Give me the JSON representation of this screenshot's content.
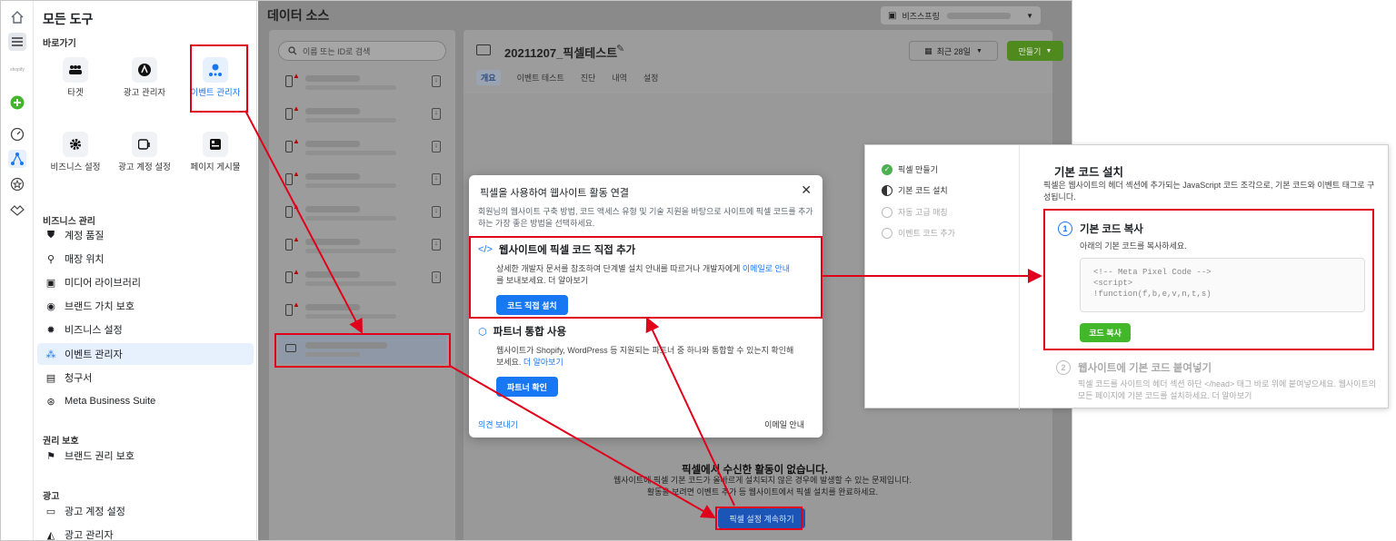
{
  "left_rail": {
    "icons": [
      "home-icon",
      "menu-icon",
      "shopify-logo",
      "add-icon",
      "dashboard-icon",
      "network-icon",
      "star-icon",
      "handshake-icon"
    ],
    "shopify_text": "shopify"
  },
  "tools": {
    "title": "모든 도구",
    "shortcuts_header": "바로가기",
    "shortcuts": [
      {
        "label": "타겟",
        "icon": "audience-icon"
      },
      {
        "label": "광고 관리자",
        "icon": "ads-manager-icon"
      },
      {
        "label": "이벤트 관리자",
        "icon": "events-manager-icon"
      },
      {
        "label": "비즈니스 설정",
        "icon": "gear-icon"
      },
      {
        "label": "광고 계정 설정",
        "icon": "ad-account-icon"
      },
      {
        "label": "페이지 게시물",
        "icon": "page-posts-icon"
      }
    ],
    "biz_header": "비즈니스 관리",
    "biz_items": [
      {
        "label": "계정 품질",
        "icon": "shield-icon"
      },
      {
        "label": "매장 위치",
        "icon": "location-icon"
      },
      {
        "label": "미디어 라이브러리",
        "icon": "media-icon"
      },
      {
        "label": "브랜드 가치 보호",
        "icon": "brand-icon"
      },
      {
        "label": "비즈니스 설정",
        "icon": "gear-icon"
      },
      {
        "label": "이벤트 관리자",
        "icon": "events-manager-icon"
      },
      {
        "label": "청구서",
        "icon": "invoice-icon"
      },
      {
        "label": "Meta Business Suite",
        "icon": "meta-icon"
      }
    ],
    "rights_header": "권리 보호",
    "rights_items": [
      {
        "label": "브랜드 권리 보호",
        "icon": "flag-icon"
      }
    ],
    "ads_header": "광고",
    "ads_items": [
      {
        "label": "광고 계정 설정",
        "icon": "ad-account-icon"
      },
      {
        "label": "광고 관리자",
        "icon": "ads-manager-icon"
      }
    ]
  },
  "main": {
    "title": "데이터 소스",
    "account_label": "비즈스프링",
    "search_placeholder": "이름 또는 ID로 검색",
    "pixel_name": "20211207_픽셀테스트",
    "period": "최근 28일",
    "create_button": "만들기",
    "tabs": [
      "개요",
      "이벤트 테스트",
      "진단",
      "내역",
      "설정"
    ],
    "empty_title": "픽셀에서 수신한 활동이 없습니다.",
    "empty_desc": "웹사이트에 픽셀 기본 코드가 올바르게 설치되지 않은 경우에 발생할 수 있는 문제입니다. 활동을 보려면 이벤트 추가 등 웹사이트에서 픽셀 설치를 완료하세요.",
    "continue_button": "픽셀 설정 계속하기"
  },
  "modal": {
    "title": "픽셀을 사용하여 웹사이트 활동 연결",
    "close": "✕",
    "desc": "회원님의 웹사이트 구축 방법, 코드 액세스 유형 및 기술 지원을 바탕으로 사이트에 픽셀 코드를 추가하는 가장 좋은 방법을 선택하세요.",
    "option1_title": "웹사이트에 픽셀 코드 직접 추가",
    "option1_desc_a": "상세한 개발자 문서를 참조하여 단계별 설치 안내를 따르거나 개발자에게 ",
    "option1_link": "이메일로 안내",
    "option1_desc_b": "를 보내보세요. 더 알아보기",
    "option1_button": "코드 직접 설치",
    "option2_title": "파트너 통합 사용",
    "option2_desc_a": "웹사이트가 Shopify, WordPress 등 지원되는 파트너 중 하나와 통합할 수 있는지 확인해보세요. ",
    "option2_link": "더 알아보기",
    "option2_button": "파트너 확인",
    "feedback": "의견 보내기",
    "email": "이메일 안내"
  },
  "zoom": {
    "steps": [
      "픽셀 만들기",
      "기본 코드 설치",
      "자동 고급 매칭",
      "이벤트 코드 추가"
    ],
    "heading": "기본 코드 설치",
    "desc": "픽셀은 웹사이트의 헤더 섹션에 추가되는 JavaScript 코드 조각으로, 기본 코드와 이벤트 태그로 구성됩니다.",
    "step1_num": "1",
    "step1_title": "기본 코드 복사",
    "step1_desc": "아래의 기본 코드를 복사하세요.",
    "code_lines": [
      "<!-- Meta Pixel Code -->",
      "<script>",
      "!function(f,b,e,v,n,t,s)"
    ],
    "copy_button": "코드 복사",
    "step2_num": "2",
    "step2_title": "웹사이트에 기본 코드 붙여넣기",
    "step2_desc": "픽셀 코드를 사이트의 헤더 섹션 하단 </head> 태그 바로 위에 붙여넣으세요. 웹사이트의 모든 페이지에 기본 코드를 설치하세요. 더 알아보기"
  },
  "colors": {
    "accent": "#1877f2",
    "highlight": "#e0001b",
    "green": "#42b72a"
  }
}
